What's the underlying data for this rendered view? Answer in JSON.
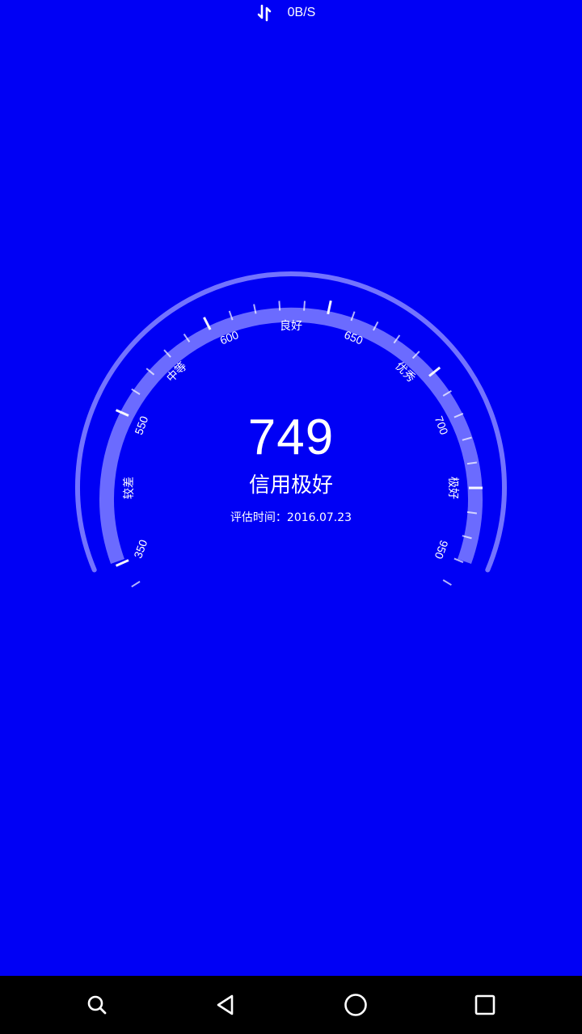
{
  "status_bar": {
    "network_speed": "0B/S",
    "traffic_icon": "data-transfer-arrows-icon"
  },
  "gauge": {
    "score": "749",
    "level_text": "信用极好",
    "eval_label": "评估时间：",
    "eval_date": "2016.07.23",
    "eval_time_text": "评估时间：2016.07.23",
    "number_labels": [
      "350",
      "550",
      "600",
      "650",
      "700",
      "950"
    ],
    "level_labels": [
      "较差",
      "中等",
      "良好",
      "优秀",
      "极好"
    ],
    "progress_fraction": 0.79,
    "colors": {
      "background": "#0000f5",
      "outer_arc": "#8f8fff",
      "inner_band": "#6b6bff",
      "tick": "#ffffff",
      "text": "#ffffff"
    }
  },
  "nav_bar": {
    "search_icon": "search-icon",
    "back_icon": "back-triangle-icon",
    "home_icon": "home-circle-icon",
    "recents_icon": "recents-square-icon"
  }
}
